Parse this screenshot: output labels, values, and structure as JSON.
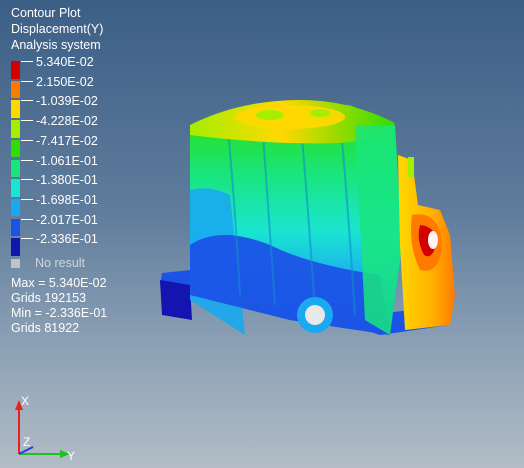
{
  "plot": {
    "header": [
      "Contour Plot",
      "Displacement(Y)",
      "Analysis system"
    ],
    "legend": [
      {
        "label": "5.340E-02",
        "color": "#d40000"
      },
      {
        "label": "2.150E-02",
        "color": "#ff7a00"
      },
      {
        "label": "-1.039E-02",
        "color": "#ffd800"
      },
      {
        "label": "-4.228E-02",
        "color": "#a5ee00"
      },
      {
        "label": "-7.417E-02",
        "color": "#2dde00"
      },
      {
        "label": "-1.061E-01",
        "color": "#19e57c"
      },
      {
        "label": "-1.380E-01",
        "color": "#1ae5d0"
      },
      {
        "label": "-1.698E-01",
        "color": "#1aa8f0"
      },
      {
        "label": "-2.017E-01",
        "color": "#1b53e6"
      },
      {
        "label": "-2.336E-01",
        "color": "#1414b0"
      }
    ],
    "no_result": "No result",
    "no_result_color": "#bfc4cb",
    "stats": [
      "Max = 5.340E-02",
      "Grids 192153",
      "Min = -2.336E-01",
      "Grids 81922"
    ]
  },
  "triad": {
    "x": "X",
    "y": "Y",
    "z": "Z"
  }
}
